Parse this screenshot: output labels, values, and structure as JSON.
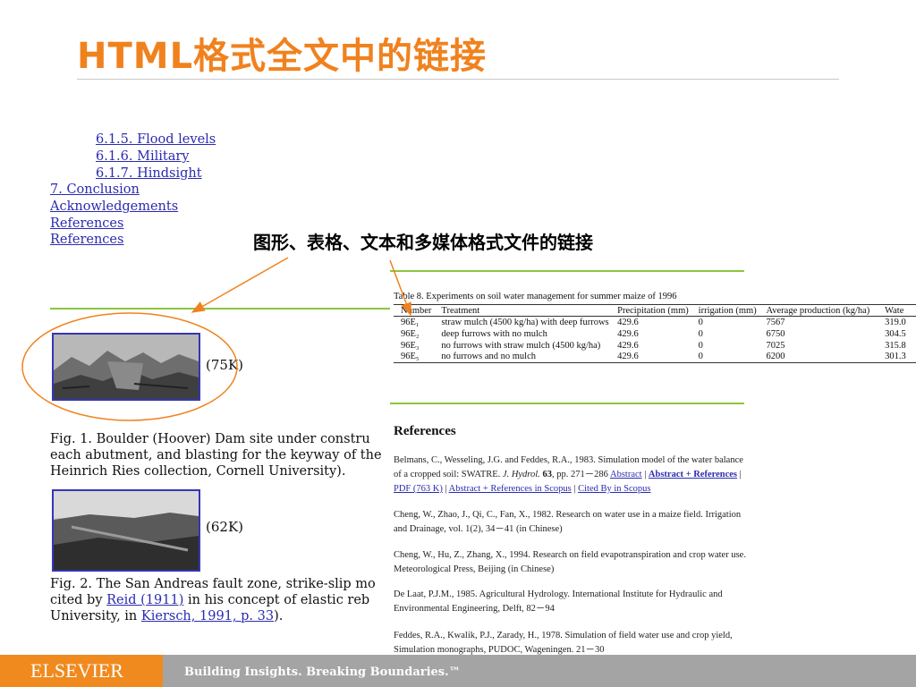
{
  "slide": {
    "title": "HTML格式全文中的链接",
    "annotation": "图形、表格、文本和多媒体格式文件的链接"
  },
  "webpage": {
    "toc_links": [
      "6.1.5. Flood levels",
      "6.1.6. Military",
      "6.1.7. Hindsight",
      "7. Conclusion",
      "Acknowledgements",
      "References",
      "References"
    ],
    "figure1": {
      "size": "(75K)",
      "caption_lines": [
        "Fig. 1. Boulder (Hoover) Dam site under constru",
        "each abutment, and blasting for the keyway of the",
        "Heinrich Ries collection, Cornell University)."
      ]
    },
    "figure2": {
      "size": "(62K)",
      "caption_line1": "Fig. 2. The San Andreas fault zone, strike-slip mo",
      "caption_line2_pre": "cited by ",
      "caption_line2_link": "Reid (1911)",
      "caption_line2_post": " in his concept of elastic reb",
      "caption_line3_pre": "University, in ",
      "caption_line3_link": "Kiersch, 1991, p. 33",
      "caption_line3_post": ")."
    }
  },
  "journal": {
    "table_caption": "Table 8. Experiments on soil water management for summer maize of 1996",
    "table_headers": [
      "Number",
      "Treatment",
      "Precipitation (mm)",
      "irrigation (mm)",
      "Average production (kg/ha)",
      "Wate"
    ],
    "table_rows": [
      [
        "96E₁",
        "straw mulch (4500 kg/ha) with deep furrows",
        "429.6",
        "0",
        "7567",
        "319.0"
      ],
      [
        "96E₂",
        "deep furrows with no mulch",
        "429.6",
        "0",
        "6750",
        "304.5"
      ],
      [
        "96E₃",
        "no furrows with straw mulch (4500 kg/ha)",
        "429.6",
        "0",
        "7025",
        "315.8"
      ],
      [
        "96E₅",
        "no furrows and no mulch",
        "429.6",
        "0",
        "6200",
        "301.3"
      ]
    ],
    "references_heading": "References",
    "ref1": {
      "text_a": "Belmans, C., Wesseling, J.G. and Feddes, R.A., 1983. Simulation model of the water balance of a cropped soil: SWATRE. ",
      "journal": "J. Hydrol.",
      "volume": " 63",
      "pages": ", pp. 271－286 ",
      "links": [
        "Abstract",
        "Abstract + References",
        "PDF (763 K)",
        "Abstract + References in Scopus",
        "Cited By in Scopus"
      ],
      "sep": " | "
    },
    "ref2": "Cheng, W., Zhao, J., Qi, C., Fan, X., 1982. Research on water use in a maize field. Irrigation and Drainage, vol. 1(2), 34－41 (in Chinese)",
    "ref3": "Cheng, W., Hu, Z., Zhang, X., 1994. Research on field evapotranspiration and crop water use. Meteorological Press, Beijing (in Chinese)",
    "ref4": "De Laat, P.J.M., 1985. Agricultural Hydrology. International Institute for Hydraulic and Environmental Engineering, Delft, 82－94",
    "ref5": "Feddes, R.A., Kwalik, P.J., Zarady, H., 1978. Simulation of field water use and crop yield, Simulation monographs, PUDOC, Wageningen. 21－30"
  },
  "footer": {
    "brand": "ELSEVIER",
    "tagline": "Building Insights. Breaking Boundaries.™"
  },
  "colors": {
    "accent_orange": "#f0821e",
    "link_blue": "#2b2bb0",
    "rule_green": "#8cc63f",
    "footer_gray": "#a4a4a4"
  },
  "icons": [
    "figure-1-thumbnail",
    "figure-2-thumbnail"
  ]
}
